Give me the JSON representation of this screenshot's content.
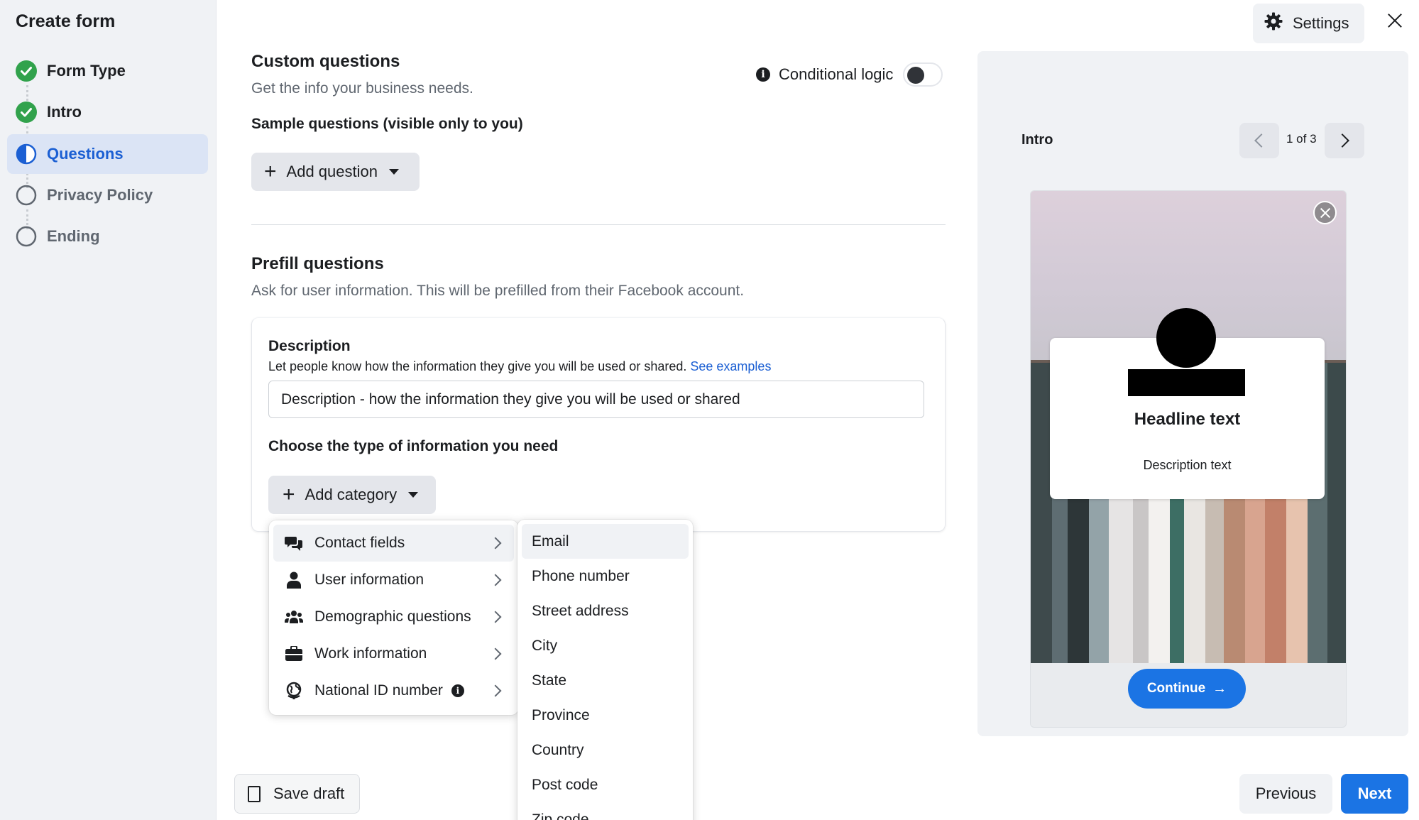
{
  "sidebar": {
    "title": "Create form",
    "steps": [
      {
        "label": "Form Type",
        "state": "done"
      },
      {
        "label": "Intro",
        "state": "done"
      },
      {
        "label": "Questions",
        "state": "active"
      },
      {
        "label": "Privacy Policy",
        "state": "pending"
      },
      {
        "label": "Ending",
        "state": "pending"
      }
    ]
  },
  "custom_questions": {
    "title": "Custom questions",
    "subtitle": "Get the info your business needs.",
    "conditional_logic_label": "Conditional logic",
    "conditional_logic_on": false,
    "sample_label": "Sample questions (visible only to you)",
    "add_question_label": "Add question"
  },
  "prefill_questions": {
    "title": "Prefill questions",
    "subtitle": "Ask for user information. This will be prefilled from their Facebook account.",
    "description_label": "Description",
    "description_hint": "Let people know how the information they give you will be used or shared.",
    "see_examples": "See examples",
    "description_value": "Description - how the information they give you will be used or shared",
    "choose_label": "Choose the type of information you need",
    "add_category_label": "Add category"
  },
  "category_menu": {
    "items": [
      {
        "label": "Contact fields",
        "icon": "chat-bubbles-icon"
      },
      {
        "label": "User information",
        "icon": "person-icon"
      },
      {
        "label": "Demographic questions",
        "icon": "people-group-icon"
      },
      {
        "label": "Work information",
        "icon": "briefcase-icon"
      },
      {
        "label": "National ID number",
        "icon": "globe-icon"
      }
    ]
  },
  "contact_fields_menu": {
    "items": [
      "Email",
      "Phone number",
      "Street address",
      "City",
      "State",
      "Province",
      "Country",
      "Post code",
      "Zip code"
    ]
  },
  "footer": {
    "save_draft": "Save draft",
    "previous": "Previous",
    "next": "Next"
  },
  "header": {
    "settings": "Settings"
  },
  "preview": {
    "title": "Intro",
    "pager": "1 of 3",
    "headline": "Headline text",
    "description": "Description text",
    "continue": "Continue",
    "continue_arrow": "→"
  },
  "colors": {
    "accent": "#1b74e4",
    "active_step_bg": "#dbe4f5",
    "done_green": "#31a24c"
  }
}
